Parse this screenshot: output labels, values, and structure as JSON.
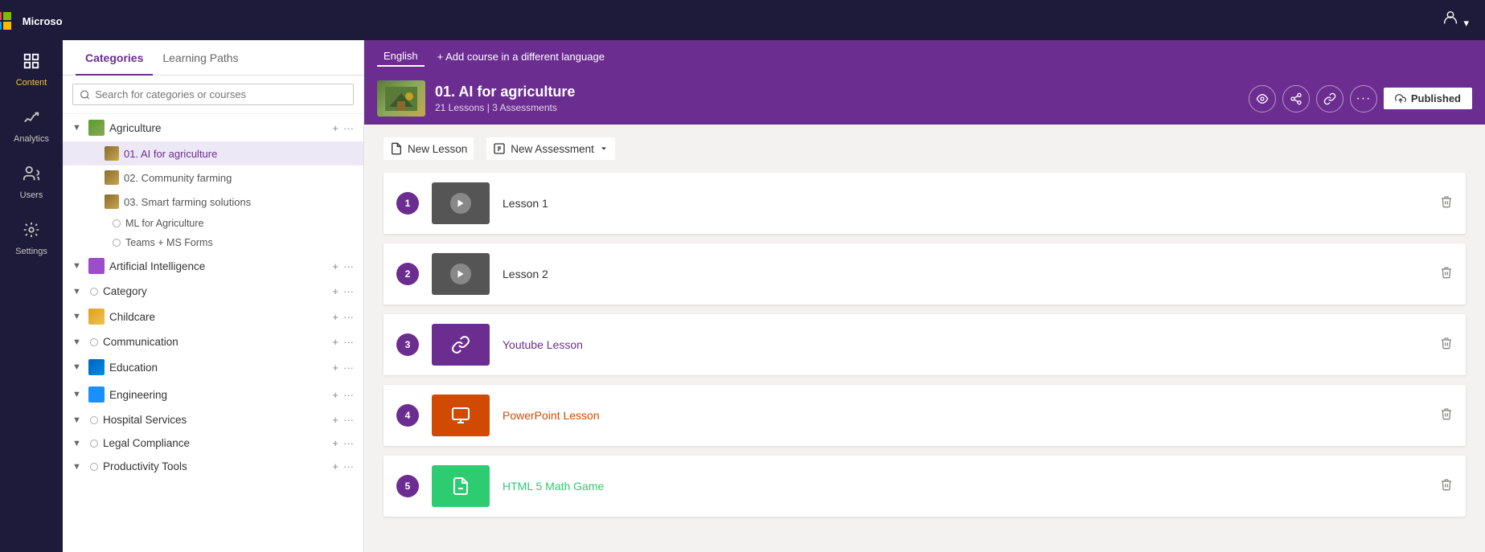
{
  "app": {
    "name": "Microsoft",
    "top_bar_user_icon": "👤"
  },
  "left_nav": {
    "items": [
      {
        "id": "content",
        "label": "Content",
        "icon": "📋",
        "active": true
      },
      {
        "id": "analytics",
        "label": "Analytics",
        "icon": "📊",
        "active": false
      },
      {
        "id": "users",
        "label": "Users",
        "icon": "👥",
        "active": false
      },
      {
        "id": "settings",
        "label": "Settings",
        "icon": "⚙️",
        "active": false
      }
    ]
  },
  "sidebar": {
    "tabs": [
      {
        "id": "categories",
        "label": "Categories",
        "active": true
      },
      {
        "id": "learning-paths",
        "label": "Learning Paths",
        "active": false
      }
    ],
    "search_placeholder": "Search for categories or courses",
    "categories": [
      {
        "id": "agriculture",
        "name": "Agriculture",
        "expanded": true,
        "has_icon": true,
        "icon_color": "#6aaa3a",
        "children": [
          {
            "id": "ai-agriculture",
            "name": "01. AI for agriculture",
            "has_icon": true,
            "icon_color": "#8a6a3a",
            "active": true
          },
          {
            "id": "community-farming",
            "name": "02. Community farming",
            "has_icon": true,
            "icon_color": "#8a6a3a"
          },
          {
            "id": "smart-farming",
            "name": "03. Smart farming solutions",
            "has_icon": true,
            "icon_color": "#8a6a3a"
          },
          {
            "id": "ml-agriculture",
            "name": "ML for Agriculture",
            "is_leaf": true
          },
          {
            "id": "teams-forms",
            "name": "Teams + MS Forms",
            "is_leaf": true
          }
        ]
      },
      {
        "id": "artificial-intelligence",
        "name": "Artificial Intelligence",
        "expanded": false,
        "has_icon": true,
        "icon_color": "#9b4dca"
      },
      {
        "id": "category",
        "name": "Category",
        "expanded": false,
        "has_icon": false
      },
      {
        "id": "childcare",
        "name": "Childcare",
        "expanded": false,
        "has_icon": true,
        "icon_color": "#f0a500"
      },
      {
        "id": "communication",
        "name": "Communication",
        "expanded": false,
        "has_icon": false
      },
      {
        "id": "education",
        "name": "Education",
        "expanded": false,
        "has_icon": true,
        "icon_color": "#0078d4"
      },
      {
        "id": "engineering",
        "name": "Engineering",
        "expanded": false,
        "has_icon": true,
        "icon_color": "#1890ff"
      },
      {
        "id": "hospital-services",
        "name": "Hospital Services",
        "expanded": false,
        "has_icon": false
      },
      {
        "id": "legal-compliance",
        "name": "Legal Compliance",
        "expanded": false,
        "has_icon": false
      },
      {
        "id": "productivity-tools",
        "name": "Productivity Tools",
        "expanded": false,
        "has_icon": false
      }
    ]
  },
  "language_bar": {
    "current_lang": "English",
    "add_lang_label": "+ Add course in a different language"
  },
  "course": {
    "title": "01. AI for agriculture",
    "lessons_count": "21 Lessons",
    "assessments_count": "3 Assessments",
    "meta": "21 Lessons | 3 Assessments",
    "status": "Published",
    "actions": [
      "👁",
      "👤",
      "🔗",
      "..."
    ]
  },
  "toolbar": {
    "new_lesson_label": "New Lesson",
    "new_assessment_label": "New Assessment"
  },
  "lessons": [
    {
      "id": 1,
      "number": "1",
      "name": "Lesson 1",
      "type": "video",
      "thumb_color": "#555555",
      "name_color": "#333"
    },
    {
      "id": 2,
      "number": "2",
      "name": "Lesson 2",
      "type": "video",
      "thumb_color": "#555555",
      "name_color": "#333"
    },
    {
      "id": 3,
      "number": "3",
      "name": "Youtube Lesson",
      "type": "youtube",
      "thumb_color": "#6c2d91",
      "name_color": "#6c2d91"
    },
    {
      "id": 4,
      "number": "4",
      "name": "PowerPoint Lesson",
      "type": "powerpoint",
      "thumb_color": "#d04a02",
      "name_color": "#d04a02"
    },
    {
      "id": 5,
      "number": "5",
      "name": "HTML 5 Math Game",
      "type": "html",
      "thumb_color": "#27ae60",
      "name_color": "#27ae60"
    }
  ],
  "icons": {
    "search": "🔍",
    "chevron_down": "▼",
    "chevron_right": "▶",
    "plus": "+",
    "ellipsis": "···",
    "new_lesson_icon": "📄",
    "new_assessment_icon": "📋",
    "delete_icon": "🗑",
    "play_icon": "▶",
    "link_icon": "🔗",
    "upload_icon": "⬆",
    "eye_icon": "👁",
    "user_icon": "👤",
    "share_icon": "🔗",
    "more_icon": "···"
  },
  "colors": {
    "purple": "#6c2d91",
    "dark_nav": "#1e1a3a",
    "white": "#ffffff",
    "light_gray": "#f3f2f1"
  }
}
